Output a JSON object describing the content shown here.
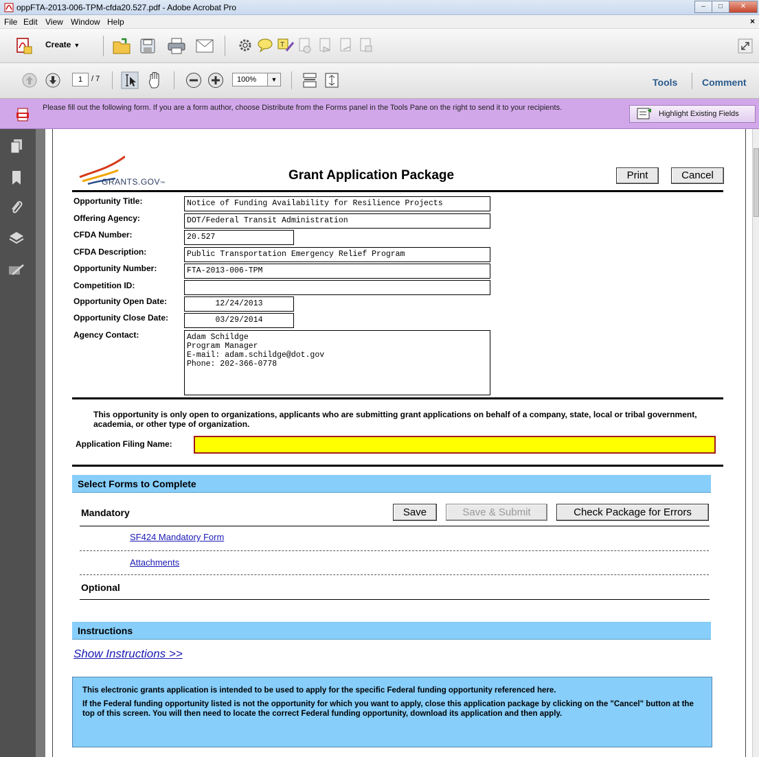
{
  "window": {
    "title": "oppFTA-2013-006-TPM-cfda20.527.pdf - Adobe Acrobat Pro",
    "minimize": "–",
    "maximize": "□",
    "close": "✕"
  },
  "menu": {
    "items": [
      "File",
      "Edit",
      "View",
      "Window",
      "Help"
    ],
    "close_doc": "×"
  },
  "toolbar": {
    "create_label": "Create",
    "page_current": "1",
    "page_total": "/ 7",
    "zoom": "100%",
    "tools_label": "Tools",
    "comment_label": "Comment"
  },
  "notice_bar": {
    "message": "Please fill out the following form. If you are a form author, choose Distribute from the Forms panel in the Tools Pane on the right to send it to your recipients.",
    "highlight_button": "Highlight Existing Fields"
  },
  "form": {
    "logo_text": "GRANTS.GOV",
    "logo_tm": "™",
    "title": "Grant Application Package",
    "print_button": "Print",
    "cancel_button": "Cancel",
    "fields": {
      "opportunity_title_label": "Opportunity Title:",
      "opportunity_title": "Notice of Funding Availability for Resilience Projects",
      "offering_agency_label": "Offering Agency:",
      "offering_agency": "DOT/Federal Transit Administration",
      "cfda_number_label": "CFDA Number:",
      "cfda_number": "20.527",
      "cfda_description_label": "CFDA Description:",
      "cfda_description": "Public Transportation Emergency Relief Program",
      "opportunity_number_label": "Opportunity Number:",
      "opportunity_number": "FTA-2013-006-TPM",
      "competition_id_label": "Competition ID:",
      "competition_id": "",
      "open_date_label": "Opportunity Open Date:",
      "open_date": "12/24/2013",
      "close_date_label": "Opportunity Close Date:",
      "close_date": "03/29/2014",
      "agency_contact_label": "Agency Contact:",
      "agency_contact": "Adam Schildge\nProgram Manager\nE-mail: adam.schildge@dot.gov\nPhone: 202-366-0778"
    },
    "eligibility_note": "This opportunity is only open to organizations, applicants who are submitting grant applications on behalf of a company, state, local or tribal government, academia, or other type of organization.",
    "filing_name_label": "Application Filing Name:",
    "filing_name": "",
    "select_forms_header": "Select Forms to Complete",
    "mandatory_label": "Mandatory",
    "save_button": "Save",
    "save_submit_button": "Save & Submit",
    "check_errors_button": "Check Package for Errors",
    "mandatory_forms": [
      "SF424 Mandatory Form",
      "Attachments"
    ],
    "optional_label": "Optional",
    "instructions_header": "Instructions",
    "show_instructions": "Show Instructions >>",
    "info_paragraph_1": "This electronic grants application is intended to be used to apply for the specific Federal funding opportunity referenced here.",
    "info_paragraph_2": "If the Federal funding opportunity listed is not the opportunity for which you want to apply, close this application package by clicking on the \"Cancel\" button at the top of this screen. You will then need to locate the correct Federal funding opportunity, download its application and then apply."
  }
}
